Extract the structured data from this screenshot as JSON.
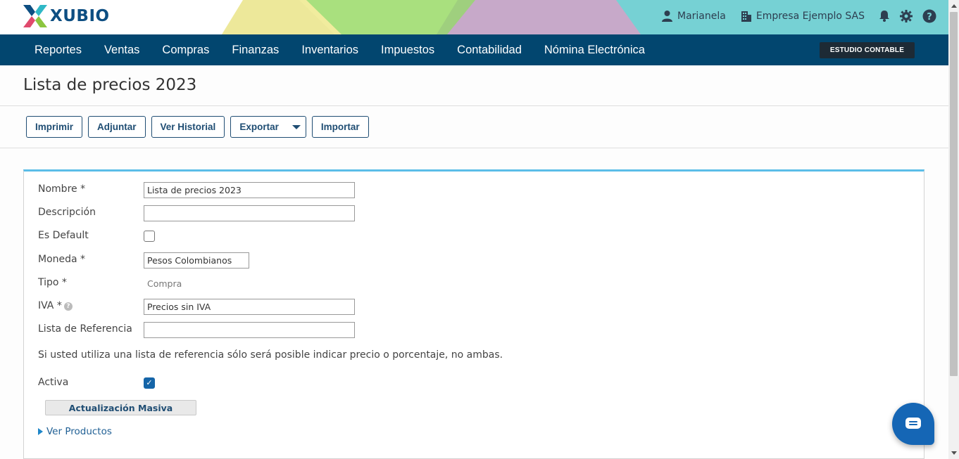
{
  "brand": {
    "name": "XUBIO"
  },
  "header": {
    "user": "Marianela",
    "company": "Empresa Ejemplo SAS",
    "icons": [
      "user-icon",
      "building-icon",
      "bell-icon",
      "gear-icon",
      "help-icon"
    ]
  },
  "nav": {
    "items": [
      "Reportes",
      "Ventas",
      "Compras",
      "Finanzas",
      "Inventarios",
      "Impuestos",
      "Contabilidad",
      "Nómina Electrónica"
    ],
    "studio": "ESTUDIO CONTABLE"
  },
  "page": {
    "title": "Lista de precios 2023"
  },
  "toolbar": {
    "print": "Imprimir",
    "attach": "Adjuntar",
    "history": "Ver Historial",
    "export": "Exportar",
    "import": "Importar"
  },
  "form": {
    "nombre_label": "Nombre *",
    "nombre_value": "Lista de precios 2023",
    "descripcion_label": "Descripción",
    "descripcion_value": "",
    "default_label": "Es Default",
    "default_checked": false,
    "moneda_label": "Moneda *",
    "moneda_value": "Pesos Colombianos",
    "tipo_label": "Tipo *",
    "tipo_value": "Compra",
    "iva_label": "IVA *",
    "iva_value": "Precios sin IVA",
    "ref_label": "Lista de Referencia",
    "ref_value": "",
    "note": "Si usted utiliza una lista de referencia sólo será posible indicar precio o porcentaje, no ambas.",
    "activa_label": "Activa",
    "activa_checked": true,
    "mass_update": "Actualización Masiva",
    "ver_productos": "Ver Productos"
  },
  "colors": {
    "nav_bg": "#02466f",
    "header_bg": "#76d1d4",
    "accent": "#5bbde8",
    "brand": "#0d4e82"
  }
}
